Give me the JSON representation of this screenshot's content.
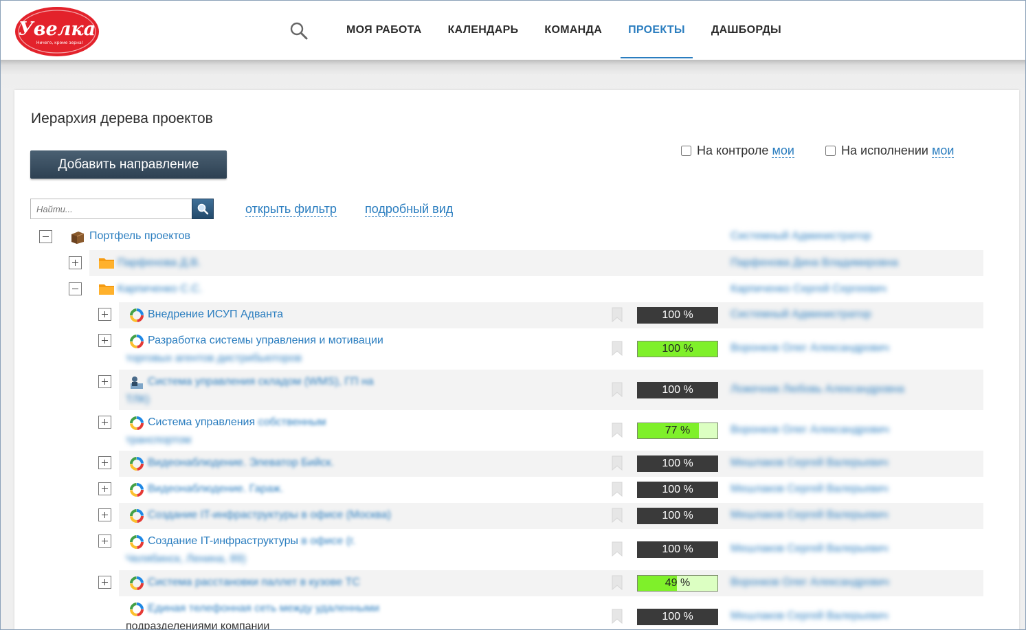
{
  "header": {
    "logo_text": "Увелка",
    "logo_tagline": "Ничего, кроме зерна!",
    "nav": [
      {
        "label": "МОЯ РАБОТА",
        "active": false
      },
      {
        "label": "КАЛЕНДАРЬ",
        "active": false
      },
      {
        "label": "КОМАНДА",
        "active": false
      },
      {
        "label": "ПРОЕКТЫ",
        "active": true
      },
      {
        "label": "ДАШБОРДЫ",
        "active": false
      }
    ]
  },
  "page": {
    "title": "Иерархия дерева проектов",
    "add_button": "Добавить направление",
    "control_label": "На контроле",
    "control_link": "мои",
    "execution_label": "На исполнении",
    "execution_link": "мои",
    "search_placeholder": "Найти...",
    "open_filter": "открыть фильтр",
    "detailed_view": "подробный вид"
  },
  "tree": {
    "root": {
      "label": "Портфель проектов",
      "owner": "Системный Администратор"
    },
    "groups": [
      {
        "label": "Парфенова Д.В.",
        "owner": "Парфенова Дина Владимировна"
      },
      {
        "label": "Карпиченко С.С.",
        "owner": "Карпиченко Сергей Сергеевич"
      }
    ],
    "projects": [
      {
        "line1": "Внедрение ИСУП Адванта",
        "line1_blur": "",
        "line2": "",
        "progress": 100,
        "progress_label": "100 %",
        "owner": "Системный Администратор"
      },
      {
        "line1": "Разработка системы управления и мотивации",
        "line1_blur": "",
        "line2": "торговых агентов дистрибьюторов",
        "progress": 100,
        "progress_label": "100 %",
        "owner": "Воронков Олег Александрович"
      },
      {
        "line1": "",
        "line1_blur": "Система управления складом (WMS), ГП на",
        "line2": "ТЛК)",
        "progress": 100,
        "progress_label": "100 %",
        "owner": "Ложечник Любовь Александровна"
      },
      {
        "line1": "Система управления",
        "line1_blur": "собственным",
        "line2": "транспортом",
        "progress": 77,
        "progress_label": "77 %",
        "owner": "Воронков Олег Александрович"
      },
      {
        "line1": "",
        "line1_blur": "Видеонаблюдение. Элеватор Бийск.",
        "line2": "",
        "progress": 100,
        "progress_label": "100 %",
        "owner": "Мешлаков Сергей Валерьевич"
      },
      {
        "line1": "",
        "line1_blur": "Видеонаблюдение. Гараж.",
        "line2": "",
        "progress": 100,
        "progress_label": "100 %",
        "owner": "Мешлаков Сергей Валерьевич"
      },
      {
        "line1": "",
        "line1_blur": "Создание IT-инфраструктуры в офисе (Москва)",
        "line2": "",
        "progress": 100,
        "progress_label": "100 %",
        "owner": "Мешлаков Сергей Валерьевич"
      },
      {
        "line1": "Создание IT-инфраструктуры",
        "line1_blur": "в офисе (г.",
        "line2": "Челябинск, Ленина, 89)",
        "progress": 100,
        "progress_label": "100 %",
        "owner": "Мешлаков Сергей Валерьевич"
      },
      {
        "line1": "",
        "line1_blur": "Система расстановки паллет в кузове ТС",
        "line2": "",
        "progress": 49,
        "progress_label": "49 %",
        "owner": "Воронков Олег Александрович"
      },
      {
        "line1": "",
        "line1_blur": "Единая телефонная сеть между удаленными",
        "line2": "подразделениями компании",
        "progress": 100,
        "progress_label": "100 %",
        "owner": "Мешлаков Сергей Валерьевич"
      }
    ]
  },
  "colors": {
    "accent": "#2a7dbf",
    "progress_dark": "#3a3a3a",
    "progress_green": "#7ff02a",
    "logo_red": "#e3222b"
  }
}
